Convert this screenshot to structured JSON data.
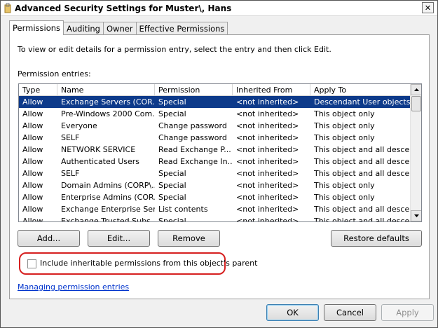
{
  "window": {
    "title": "Advanced Security Settings for Muster\\, Hans",
    "close_glyph": "✕"
  },
  "tabs": [
    {
      "label": "Permissions",
      "active": true
    },
    {
      "label": "Auditing",
      "active": false
    },
    {
      "label": "Owner",
      "active": false
    },
    {
      "label": "Effective Permissions",
      "active": false
    }
  ],
  "permissions": {
    "instructions": "To view or edit details for a permission entry, select the entry and then click Edit.",
    "entries_label": "Permission entries:",
    "columns": [
      "Type",
      "Name",
      "Permission",
      "Inherited From",
      "Apply To"
    ],
    "rows": [
      [
        "Allow",
        "Exchange Servers (COR...",
        "Special",
        "<not inherited>",
        "Descendant User objects"
      ],
      [
        "Allow",
        "Pre-Windows 2000 Com...",
        "Special",
        "<not inherited>",
        "This object only"
      ],
      [
        "Allow",
        "Everyone",
        "Change password",
        "<not inherited>",
        "This object only"
      ],
      [
        "Allow",
        "SELF",
        "Change password",
        "<not inherited>",
        "This object only"
      ],
      [
        "Allow",
        "NETWORK SERVICE",
        "Read Exchange P...",
        "<not inherited>",
        "This object and all desce..."
      ],
      [
        "Allow",
        "Authenticated Users",
        "Read Exchange In...",
        "<not inherited>",
        "This object and all desce..."
      ],
      [
        "Allow",
        "SELF",
        "Special",
        "<not inherited>",
        "This object and all desce..."
      ],
      [
        "Allow",
        "Domain Admins (CORP\\...",
        "Special",
        "<not inherited>",
        "This object only"
      ],
      [
        "Allow",
        "Enterprise Admins (COR...",
        "Special",
        "<not inherited>",
        "This object only"
      ],
      [
        "Allow",
        "Exchange Enterprise Ser...",
        "List contents",
        "<not inherited>",
        "This object and all desce..."
      ],
      [
        "Allow",
        "Exchange Trusted Subs...",
        "Special",
        "<not inherited>",
        "This object and all desce..."
      ]
    ],
    "selected_row": 0,
    "buttons": {
      "add": "Add...",
      "edit": "Edit...",
      "remove": "Remove",
      "restore": "Restore defaults"
    },
    "include_inheritable_label": "Include inheritable permissions from this object's parent",
    "include_inheritable_checked": false,
    "help_link": "Managing permission entries"
  },
  "dialog_buttons": {
    "ok": "OK",
    "cancel": "Cancel",
    "apply": "Apply"
  },
  "colors": {
    "selection": "#0d3a8a",
    "highlight_outline": "#d62020",
    "link": "#0033cc"
  }
}
